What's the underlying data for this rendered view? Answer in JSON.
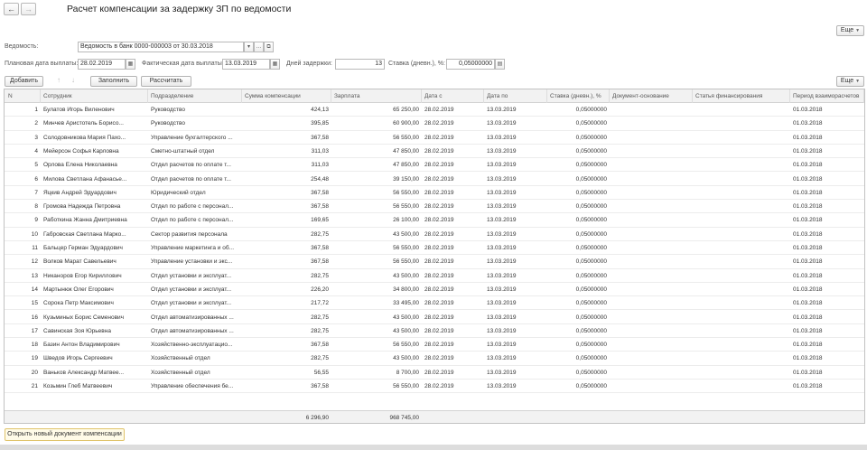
{
  "nav": {
    "back": "←",
    "forward": "→"
  },
  "title": "Расчет компенсации за задержку ЗП по ведомости",
  "more_label": "Еще",
  "fields": {
    "statement_label": "Ведомость:",
    "statement_value": "Ведомость в банк 0000-000003 от 30.03.2018",
    "planned_date_label": "Плановая дата выплаты:",
    "planned_date_value": "28.02.2019",
    "actual_date_label": "Фактическая дата выплаты:",
    "actual_date_value": "13.03.2019",
    "delay_days_label": "Дней задержки:",
    "delay_days_value": "13",
    "rate_label": "Ставка (дневн.), %:",
    "rate_value": "0,05000000"
  },
  "toolbar": {
    "add": "Добавить",
    "up": "↑",
    "down": "↓",
    "fill": "Заполнить",
    "calculate": "Рассчитать"
  },
  "table": {
    "columns": [
      "N",
      "Сотрудник",
      "Подразделение",
      "Сумма компенсации",
      "Зарплата",
      "Дата с",
      "Дата по",
      "Ставка (дневн.), %",
      "Документ-основание",
      "Статья финансирования",
      "Период взаиморасчетов"
    ],
    "rows": [
      [
        "1",
        "Булатов Игорь Виленович",
        "Руководство",
        "424,13",
        "65 250,00",
        "28.02.2019",
        "13.03.2019",
        "0,05000000",
        "",
        "",
        "01.03.2018"
      ],
      [
        "2",
        "Минчев Аристотель Борисо...",
        "Руководство",
        "395,85",
        "60 900,00",
        "28.02.2019",
        "13.03.2019",
        "0,05000000",
        "",
        "",
        "01.03.2018"
      ],
      [
        "3",
        "Солодовникова Мария Пахо...",
        "Управление бухгалтерского ...",
        "367,58",
        "56 550,00",
        "28.02.2019",
        "13.03.2019",
        "0,05000000",
        "",
        "",
        "01.03.2018"
      ],
      [
        "4",
        "Мейерсон Софья Карловна",
        "Сметно-штатный отдел",
        "311,03",
        "47 850,00",
        "28.02.2019",
        "13.03.2019",
        "0,05000000",
        "",
        "",
        "01.03.2018"
      ],
      [
        "5",
        "Орлова Елена Николаевна",
        "Отдел расчетов по оплате т...",
        "311,03",
        "47 850,00",
        "28.02.2019",
        "13.03.2019",
        "0,05000000",
        "",
        "",
        "01.03.2018"
      ],
      [
        "6",
        "Милова Светлана Афанасье...",
        "Отдел расчетов по оплате т...",
        "254,48",
        "39 150,00",
        "28.02.2019",
        "13.03.2019",
        "0,05000000",
        "",
        "",
        "01.03.2018"
      ],
      [
        "7",
        "Яцкив Андрей Эдуардович",
        "Юридический отдел",
        "367,58",
        "56 550,00",
        "28.02.2019",
        "13.03.2019",
        "0,05000000",
        "",
        "",
        "01.03.2018"
      ],
      [
        "8",
        "Громова Надежда Петровна",
        "Отдел по работе с персонал...",
        "367,58",
        "56 550,00",
        "28.02.2019",
        "13.03.2019",
        "0,05000000",
        "",
        "",
        "01.03.2018"
      ],
      [
        "9",
        "Работкина Жанна Дмитриевна",
        "Отдел по работе с персонал...",
        "169,65",
        "26 100,00",
        "28.02.2019",
        "13.03.2019",
        "0,05000000",
        "",
        "",
        "01.03.2018"
      ],
      [
        "10",
        "Габровская Светлана Марко...",
        "Сектор развития персонала",
        "282,75",
        "43 500,00",
        "28.02.2019",
        "13.03.2019",
        "0,05000000",
        "",
        "",
        "01.03.2018"
      ],
      [
        "11",
        "Бальцер Герман Эдуардович",
        "Управление маркетинга и об...",
        "367,58",
        "56 550,00",
        "28.02.2019",
        "13.03.2019",
        "0,05000000",
        "",
        "",
        "01.03.2018"
      ],
      [
        "12",
        "Волков Марат Савельевич",
        "Управление установки и экс...",
        "367,58",
        "56 550,00",
        "28.02.2019",
        "13.03.2019",
        "0,05000000",
        "",
        "",
        "01.03.2018"
      ],
      [
        "13",
        "Никаноров Егор Кириллович",
        "Отдел установки и эксплуат...",
        "282,75",
        "43 500,00",
        "28.02.2019",
        "13.03.2019",
        "0,05000000",
        "",
        "",
        "01.03.2018"
      ],
      [
        "14",
        "Мартынюк Олег Егорович",
        "Отдел установки и эксплуат...",
        "226,20",
        "34 800,00",
        "28.02.2019",
        "13.03.2019",
        "0,05000000",
        "",
        "",
        "01.03.2018"
      ],
      [
        "15",
        "Сорока Петр Максимович",
        "Отдел установки и эксплуат...",
        "217,72",
        "33 495,00",
        "28.02.2019",
        "13.03.2019",
        "0,05000000",
        "",
        "",
        "01.03.2018"
      ],
      [
        "16",
        "Кузьминых Борис Семенович",
        "Отдел автоматизированных ...",
        "282,75",
        "43 500,00",
        "28.02.2019",
        "13.03.2019",
        "0,05000000",
        "",
        "",
        "01.03.2018"
      ],
      [
        "17",
        "Савинская Зоя Юрьевна",
        "Отдел автоматизированных ...",
        "282,75",
        "43 500,00",
        "28.02.2019",
        "13.03.2019",
        "0,05000000",
        "",
        "",
        "01.03.2018"
      ],
      [
        "18",
        "Базин Антон Владимирович",
        "Хозяйственно-эксплуатацио...",
        "367,58",
        "56 550,00",
        "28.02.2019",
        "13.03.2019",
        "0,05000000",
        "",
        "",
        "01.03.2018"
      ],
      [
        "19",
        "Шведов Игорь Сергеевич",
        "Хозяйственный отдел",
        "282,75",
        "43 500,00",
        "28.02.2019",
        "13.03.2019",
        "0,05000000",
        "",
        "",
        "01.03.2018"
      ],
      [
        "20",
        "Ваньков Александр Матвее...",
        "Хозяйственный отдел",
        "56,55",
        "8 700,00",
        "28.02.2019",
        "13.03.2019",
        "0,05000000",
        "",
        "",
        "01.03.2018"
      ],
      [
        "21",
        "Козьмин Глеб Матвеевич",
        "Управление обеспечения бе...",
        "367,58",
        "56 550,00",
        "28.02.2019",
        "13.03.2019",
        "0,05000000",
        "",
        "",
        "01.03.2018"
      ]
    ],
    "totals": {
      "compensation": "6 296,90",
      "salary": "968 745,00"
    }
  },
  "open_doc_button": "Открыть новый документ компенсации"
}
